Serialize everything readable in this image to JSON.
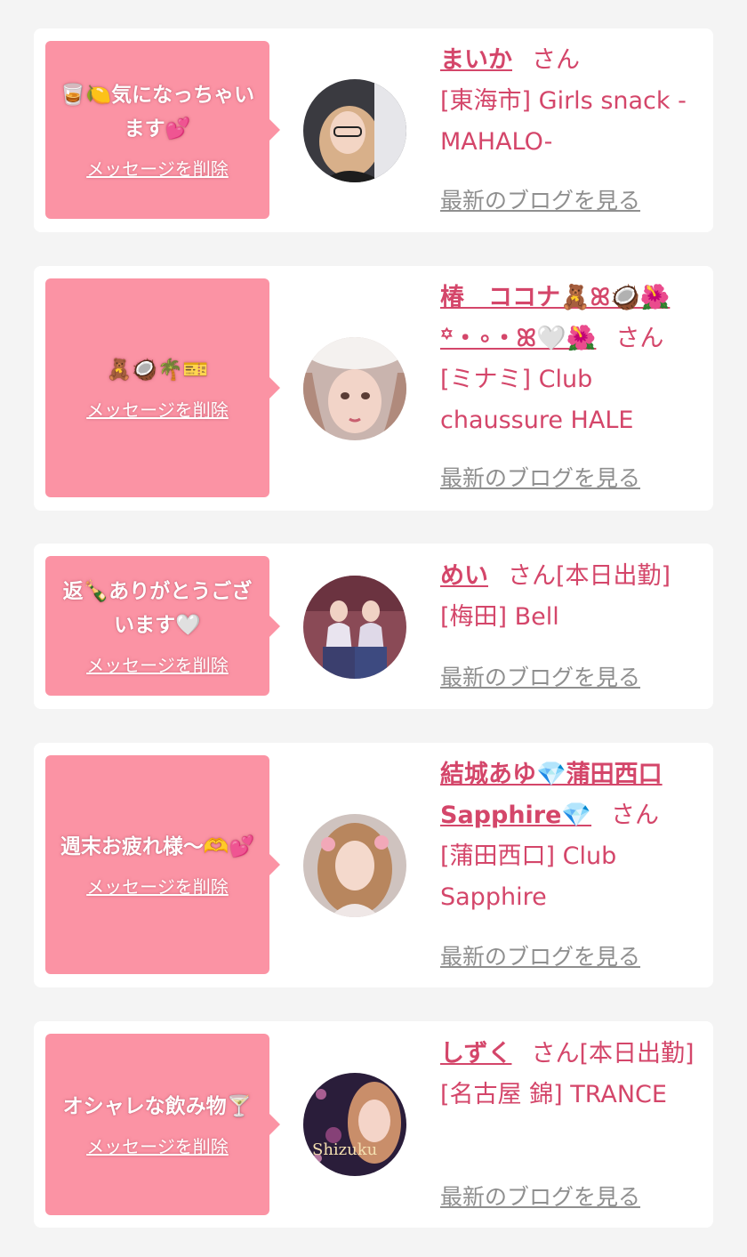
{
  "delete_label": "メッセージを削除",
  "blog_label": "最新のブログを見る",
  "san_label": "さん",
  "cards": [
    {
      "message": "🥃🍋気になっちゃいます💕",
      "name": "まいか",
      "san_suffix": "",
      "area_shop": "[東海市] Girls snack -MAHALO-"
    },
    {
      "message": "🧸🥥🌴🎫",
      "name": "椿　ココナ🧸ꕤ🥥🌺꙳・∘・ꕤ🤍🌺",
      "san_suffix": "",
      "area_shop": "[ミナミ] Club chaussure HALE"
    },
    {
      "message": "返🍾ありがとうございます🤍",
      "name": "めい",
      "san_suffix": "[本日出勤]",
      "area_shop": "[梅田] Bell"
    },
    {
      "message": "週末お疲れ様〜🫶💕",
      "name": "結城あゆ💎蒲田西口Sapphire💎",
      "san_suffix": "",
      "area_shop": "[蒲田西口] Club Sapphire"
    },
    {
      "message": "オシャレな飲み物🍸",
      "name": "しずく",
      "san_suffix": "[本日出勤]",
      "area_shop": "[名古屋 錦] TRANCE"
    }
  ],
  "colors": {
    "page_bg": "#f4f4f4",
    "bubble": "#fb93a4",
    "name_pink": "#d4466a",
    "blog_gray": "#8f8f8f"
  },
  "avatar_icons": [
    "avatar-photo",
    "avatar-photo",
    "avatar-photo",
    "avatar-photo",
    "avatar-photo"
  ]
}
